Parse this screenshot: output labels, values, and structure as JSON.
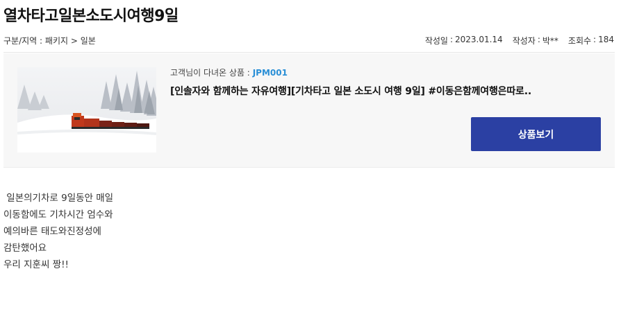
{
  "post": {
    "title": "열차타고일본소도시여행9일",
    "category_label": "구분/지역",
    "category_value": "패키지 > 일본",
    "date_label": "작성일",
    "date_value": "2023.01.14",
    "author_label": "작성자",
    "author_value": "박**",
    "views_label": "조회수",
    "views_value": "184"
  },
  "product": {
    "label": "고객님이 다녀온 상품 :",
    "code": "JPM001",
    "name": "[인솔자와 함께하는 자유여행][기차타고 일본 소도시 여행 9일] #이동은함께여행은따로..",
    "button_label": "상품보기"
  },
  "content": {
    "lines": [
      " 일본의기차로 9일동안 매일",
      "이동함에도 기차시간 엄수와",
      "예의바른 태도와진정성에",
      "감탄했어요",
      "우리 지훈씨 짱!!"
    ]
  }
}
